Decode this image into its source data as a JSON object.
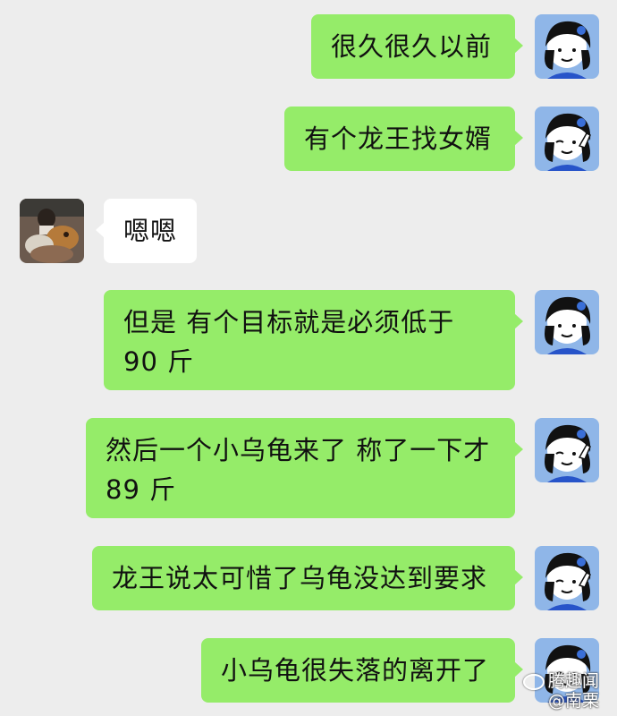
{
  "chat": {
    "messages": [
      {
        "side": "right",
        "text": "很久很久以前"
      },
      {
        "side": "right",
        "text": "有个龙王找女婿"
      },
      {
        "side": "left",
        "text": "嗯嗯"
      },
      {
        "side": "right",
        "text": "但是 有个目标就是必须低于 90 斤"
      },
      {
        "side": "right",
        "text": "然后一个小乌龟来了 称了一下才 89 斤"
      },
      {
        "side": "right",
        "text": "龙王说太可惜了乌龟没达到要求"
      },
      {
        "side": "right",
        "text": "小乌龟很失落的离开了"
      }
    ],
    "bubble_green": "#95ec69",
    "bubble_white": "#ffffff",
    "background": "#ededed"
  },
  "watermark": {
    "line1": "腾趣闻",
    "line2": "@南栗"
  }
}
